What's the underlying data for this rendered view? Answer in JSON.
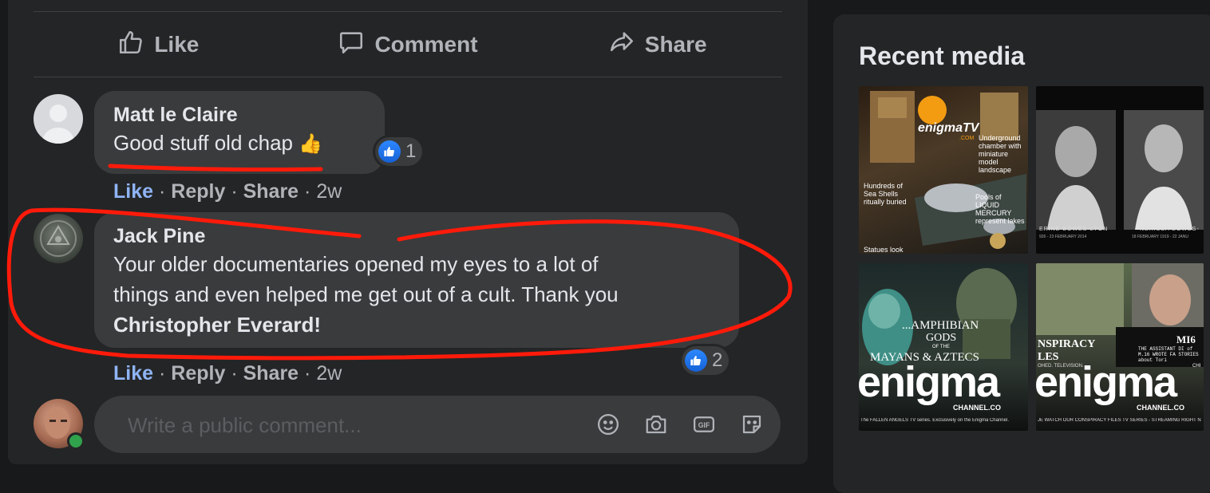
{
  "post_actions": {
    "like": "Like",
    "comment": "Comment",
    "share": "Share"
  },
  "comments": [
    {
      "author": "Matt le Claire",
      "text": "Good stuff old chap",
      "emoji": "👍",
      "reaction_count": "1",
      "actions": {
        "like": "Like",
        "reply": "Reply",
        "share": "Share",
        "time": "2w"
      }
    },
    {
      "author": "Jack Pine",
      "text_line1": "Your older documentaries opened my eyes to a lot of",
      "text_line2": "things and even helped me get out of a cult. Thank you",
      "mention": "Christopher Everard",
      "mention_suffix": "!",
      "reaction_count": "2",
      "actions": {
        "like": "Like",
        "reply": "Reply",
        "share": "Share",
        "time": "2w"
      }
    }
  ],
  "composer": {
    "placeholder": "Write a public comment..."
  },
  "sidebar": {
    "title": "Recent media",
    "media": [
      {
        "logo": "enigmaTV",
        "logo_sub": ".COM",
        "caption_1": "Underground chamber with miniature model landscape",
        "caption_2": "Hundreds of Sea Shells ritually buried",
        "caption_3": "Pools of LIQUID MERCURY represent lakes",
        "caption_4": "Statues look"
      },
      {
        "caption_left": "ERINE BOWES-LYON",
        "caption_left_dates": "926 - 23 FEBRUARY 2014",
        "caption_right": "NERISSA BOWES-",
        "caption_right_dates": "18 FEBRUARY 1919 - 22 JANU"
      },
      {
        "title_1": "...AMPHIBIAN",
        "title_2": "GODS",
        "title_3": "OF THE",
        "title_4": "MAYANS & AZTECS",
        "logo": "enigma",
        "logo_sub": "CHANNEL.CO",
        "footer": "The FALLEN ANGELS TV series. Exclusively on the Enigma Channel."
      },
      {
        "title_1": "NSPIRACY",
        "title_2": "LES",
        "small_1": "OHED. TELEVISION.",
        "badge": "MI6",
        "badge_text": "THE ASSISTANT DI of M.16 WROTE FA STORIES about Tori",
        "badge_text_2": "CHI",
        "logo": "enigma",
        "logo_sub": "CHANNEL.CO",
        "footer": "JE WATCH OUR CONSPIRACY FILES TV SERIES - STREAMING RIGHT N"
      }
    ]
  },
  "colors": {
    "page_bg": "#18191a",
    "card_bg": "#242526",
    "bubble_bg": "#3a3b3c",
    "link_like": "#8fb4f5",
    "annotation_red": "#ff1a0a",
    "like_blue": "#1877f2"
  }
}
